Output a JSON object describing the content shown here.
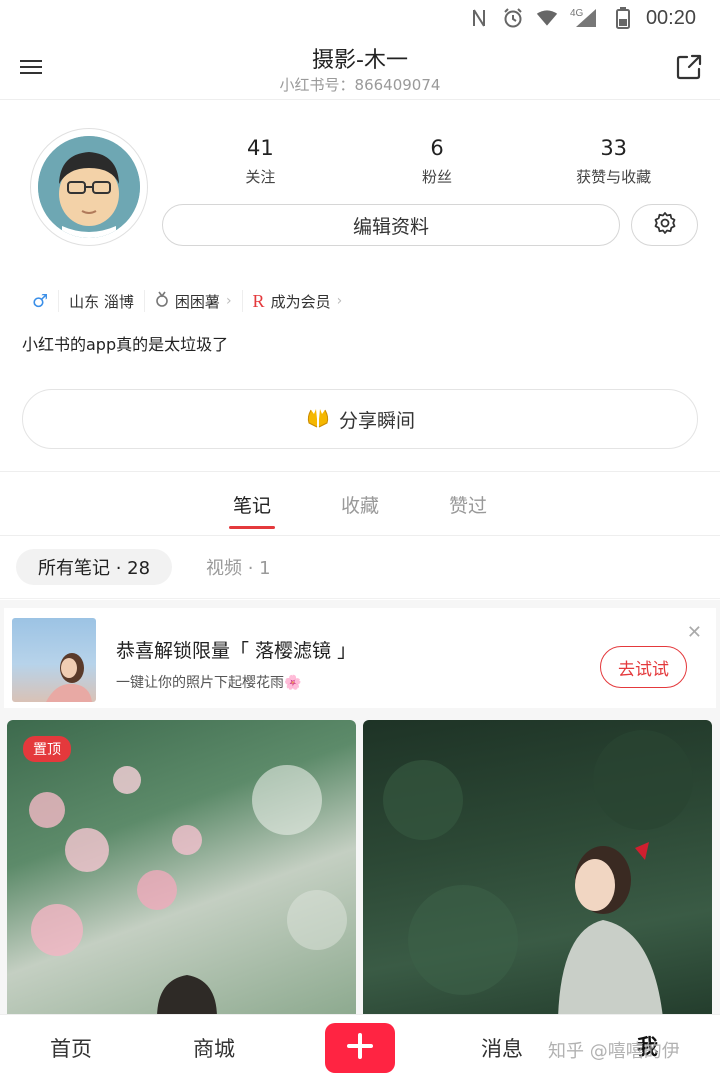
{
  "status_bar": {
    "time": "00:20",
    "network": "4G"
  },
  "header": {
    "title": "摄影-木一",
    "subtitle": "小红书号：866409074"
  },
  "profile": {
    "stats": [
      {
        "value": "41",
        "label": "关注"
      },
      {
        "value": "6",
        "label": "粉丝"
      },
      {
        "value": "33",
        "label": "获赞与收藏"
      }
    ],
    "edit_label": "编辑资料",
    "location": "山东  淄博",
    "tag2": "困困薯",
    "tag3": "成为会员",
    "bio": "小红书的app真的是太垃圾了",
    "moment_label": "分享瞬间"
  },
  "tabs": [
    {
      "label": "笔记"
    },
    {
      "label": "收藏"
    },
    {
      "label": "赞过"
    }
  ],
  "filters": {
    "active": "所有笔记 · 28",
    "other": "视频 · 1"
  },
  "promo": {
    "title": "恭喜解锁限量「 落樱滤镜 」",
    "subtitle": "一键让你的照片下起樱花雨🌸",
    "button": "去试试"
  },
  "feed": {
    "pin_label": "置顶"
  },
  "bottom_nav": {
    "home": "首页",
    "mall": "商城",
    "messages": "消息",
    "me": "我"
  },
  "watermark": "知乎 @嘻嘻的伊",
  "colors": {
    "accent": "#e4393c",
    "brand_red": "#ff2442",
    "gender_blue": "#3b8fe8"
  }
}
